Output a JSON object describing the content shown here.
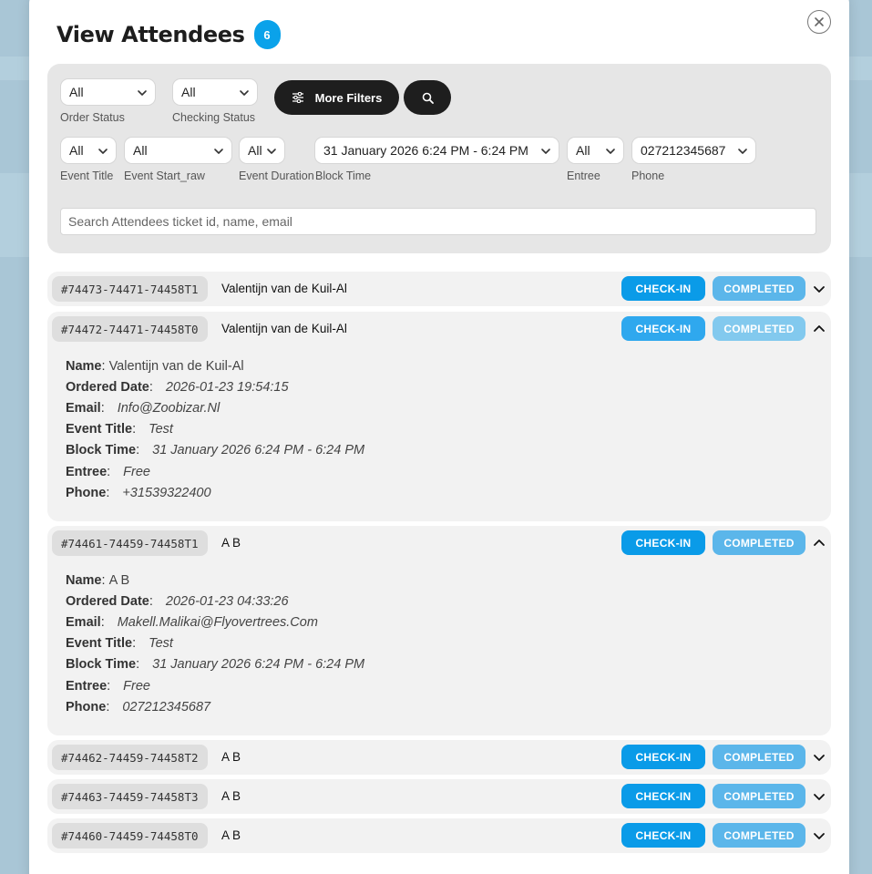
{
  "modal": {
    "title": "View Attendees",
    "count": "6"
  },
  "filters": {
    "order_status": {
      "value": "All",
      "label": "Order Status"
    },
    "checking_status": {
      "value": "All",
      "label": "Checking Status"
    },
    "more_filters_label": "More Filters",
    "event_title": {
      "value": "All",
      "label": "Event Title"
    },
    "event_start": {
      "value": "All",
      "label": "Event Start_raw"
    },
    "event_duration": {
      "value": "All",
      "label": "Event Duration"
    },
    "block_time": {
      "value": "31 January 2026 6:24 PM - 6:24 PM",
      "label": "Block Time"
    },
    "entree": {
      "value": "All",
      "label": "Entree"
    },
    "phone": {
      "value": "027212345687",
      "label": "Phone"
    },
    "search_placeholder": "Search Attendees ticket id, name, email"
  },
  "labels": {
    "name": "Name",
    "ordered_date": "Ordered Date",
    "email": "Email",
    "event_title": "Event Title",
    "block_time": "Block Time",
    "entree": "Entree",
    "phone": "Phone"
  },
  "attendees": [
    {
      "ticket_id": "#74473-74471-74458T1",
      "name": "Valentijn van de Kuil-Al",
      "checkin_label": "CHECK-IN",
      "status": "COMPLETED",
      "expanded": false
    },
    {
      "ticket_id": "#74472-74471-74458T0",
      "name": "Valentijn van de Kuil-Al",
      "checkin_label": "CHECK-IN",
      "status": "COMPLETED",
      "expanded": true,
      "details": {
        "name": "Valentijn van de Kuil-Al",
        "ordered_date": "2026-01-23 19:54:15",
        "email": "Info@Zoobizar.Nl",
        "event_title": "Test",
        "block_time": "31 January 2026 6:24 PM - 6:24 PM",
        "entree": "Free",
        "phone": "+31539322400"
      }
    },
    {
      "ticket_id": "#74461-74459-74458T1",
      "name": "A B",
      "checkin_label": "CHECK-IN",
      "status": "COMPLETED",
      "expanded": true,
      "details": {
        "name": "A B",
        "ordered_date": "2026-01-23 04:33:26",
        "email": "Makell.Malikai@Flyovertrees.Com",
        "event_title": "Test",
        "block_time": "31 January 2026 6:24 PM - 6:24 PM",
        "entree": "Free",
        "phone": "027212345687"
      }
    },
    {
      "ticket_id": "#74462-74459-74458T2",
      "name": "A B",
      "checkin_label": "CHECK-IN",
      "status": "COMPLETED",
      "expanded": false
    },
    {
      "ticket_id": "#74463-74459-74458T3",
      "name": "A B",
      "checkin_label": "CHECK-IN",
      "status": "COMPLETED",
      "expanded": false
    },
    {
      "ticket_id": "#74460-74459-74458T0",
      "name": "A B",
      "checkin_label": "CHECK-IN",
      "status": "COMPLETED",
      "expanded": false
    }
  ],
  "colors": {
    "accent": "#0a9be8",
    "badge": "#0aa2ea",
    "completed": "#5bb6ea",
    "dark_button": "#1e1e1e"
  },
  "icons": {
    "close": "close-icon",
    "filters": "sliders-icon",
    "search": "search-icon",
    "expand": "chevron-down-icon",
    "collapse": "chevron-up-icon"
  }
}
